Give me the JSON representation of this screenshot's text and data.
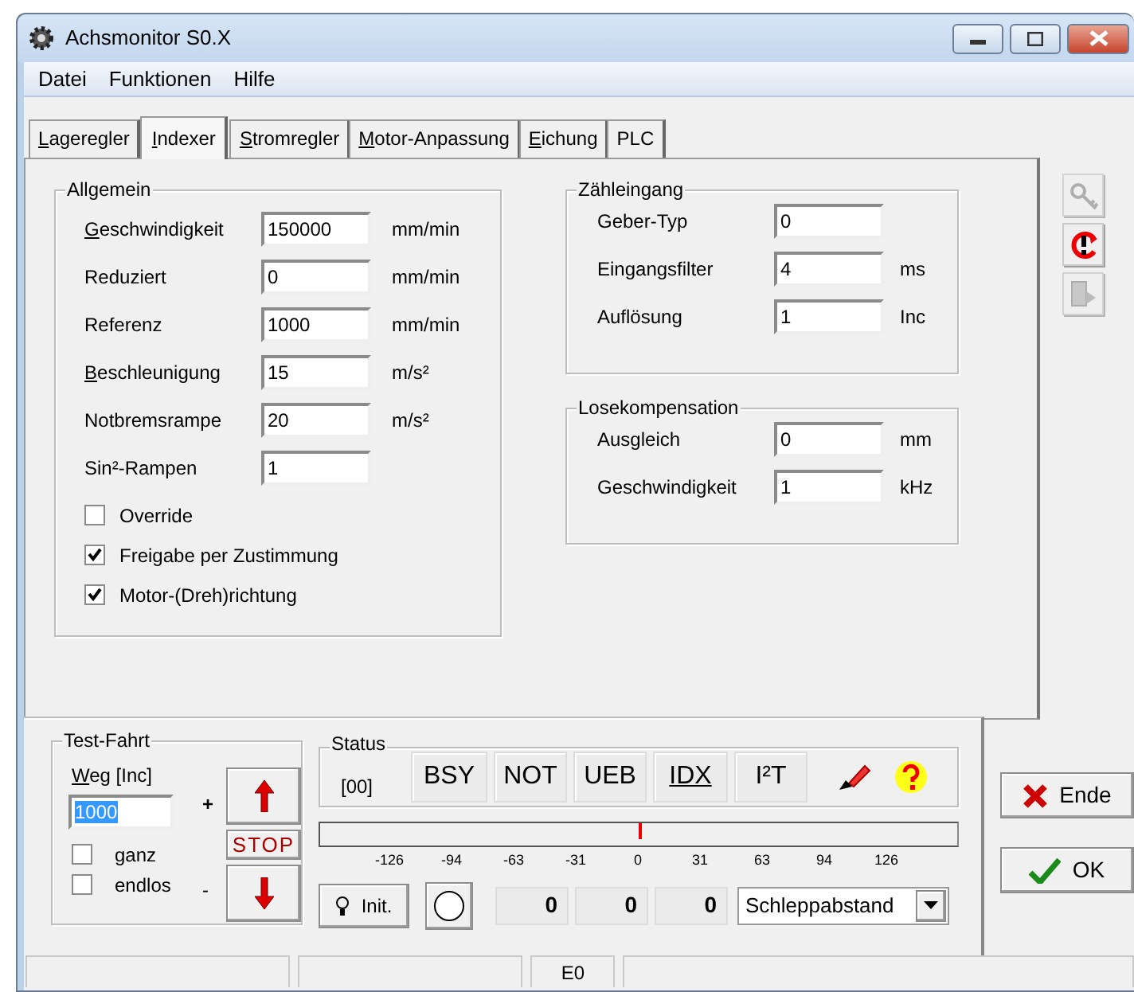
{
  "window": {
    "title": "Achsmonitor S0.X"
  },
  "menu": [
    {
      "label": "Datei"
    },
    {
      "label": "Funktionen"
    },
    {
      "label": "Hilfe"
    }
  ],
  "tabs": [
    {
      "label": "Lageregler",
      "selected": false,
      "mnemonic": true
    },
    {
      "label": "Indexer",
      "selected": true,
      "mnemonic": true
    },
    {
      "label": "Stromregler",
      "selected": false,
      "mnemonic": true
    },
    {
      "label": "Motor-Anpassung",
      "selected": false,
      "mnemonic": true
    },
    {
      "label": "Eichung",
      "selected": false,
      "mnemonic": true
    },
    {
      "label": "PLC",
      "selected": false,
      "mnemonic": false
    }
  ],
  "allgemein": {
    "title": "Allgemein",
    "fields": [
      {
        "label": "Geschwindigkeit",
        "mnemonic": true,
        "value": "150000",
        "unit": "mm/min"
      },
      {
        "label": "Reduziert",
        "mnemonic": false,
        "value": "0",
        "unit": "mm/min"
      },
      {
        "label": "Referenz",
        "mnemonic": false,
        "value": "1000",
        "unit": "mm/min"
      },
      {
        "label": "Beschleunigung",
        "mnemonic": true,
        "value": "15",
        "unit": "m/s²"
      },
      {
        "label": "Notbremsrampe",
        "mnemonic": false,
        "value": "20",
        "unit": "m/s²"
      },
      {
        "label": "Sin²-Rampen",
        "mnemonic": false,
        "value": "1"
      }
    ],
    "checkboxes": [
      {
        "label": "Override",
        "checked": false
      },
      {
        "label": "Freigabe per Zustimmung",
        "checked": true
      },
      {
        "label": "Motor-(Dreh)richtung",
        "checked": true
      }
    ]
  },
  "zaehleingang": {
    "title": "Zähleingang",
    "fields": [
      {
        "label": "Geber-Typ",
        "value": "0"
      },
      {
        "label": "Eingangsfilter",
        "value": "4",
        "unit": "ms"
      },
      {
        "label": "Auflösung",
        "value": "1",
        "unit": "Inc"
      }
    ]
  },
  "losekompensation": {
    "title": "Losekompensation",
    "fields": [
      {
        "label": "Ausgleich",
        "value": "0",
        "unit": "mm"
      },
      {
        "label": "Geschwindigkeit",
        "value": "1",
        "unit": "kHz"
      }
    ]
  },
  "side_tools": [
    {
      "kind": "key",
      "disabled": true
    },
    {
      "kind": "alert",
      "disabled": false
    },
    {
      "kind": "export",
      "disabled": true
    }
  ],
  "test_fahrt": {
    "title": "Test-Fahrt",
    "weg_label": "Weg [Inc]",
    "weg_mnemonic": true,
    "weg_value": "1000",
    "weg_highlighted": true,
    "plus": "+",
    "minus": "-",
    "stop": "STOP",
    "checkboxes": [
      {
        "label": "ganz",
        "checked": false
      },
      {
        "label": "endlos",
        "checked": false
      }
    ]
  },
  "status": {
    "title": "Status",
    "code": "[00]",
    "flags": [
      {
        "label": "BSY",
        "underlined": false
      },
      {
        "label": "NOT",
        "underlined": false
      },
      {
        "label": "UEB",
        "underlined": false
      },
      {
        "label": "IDX",
        "underlined": true
      },
      {
        "label": "I²T",
        "underlined": false
      }
    ],
    "scale": {
      "level": 0.5,
      "ticks": [
        "-126",
        "-94",
        "-63",
        "-31",
        "0",
        "31",
        "63",
        "94",
        "126"
      ]
    },
    "init_button": "Init.",
    "readouts": [
      "0",
      "0",
      "0"
    ],
    "select": {
      "value": "Schleppabstand"
    }
  },
  "buttons": [
    {
      "kind": "cancel",
      "label": "Ende"
    },
    {
      "kind": "ok",
      "label": "OK"
    }
  ],
  "status_bar": {
    "text": "E0"
  }
}
